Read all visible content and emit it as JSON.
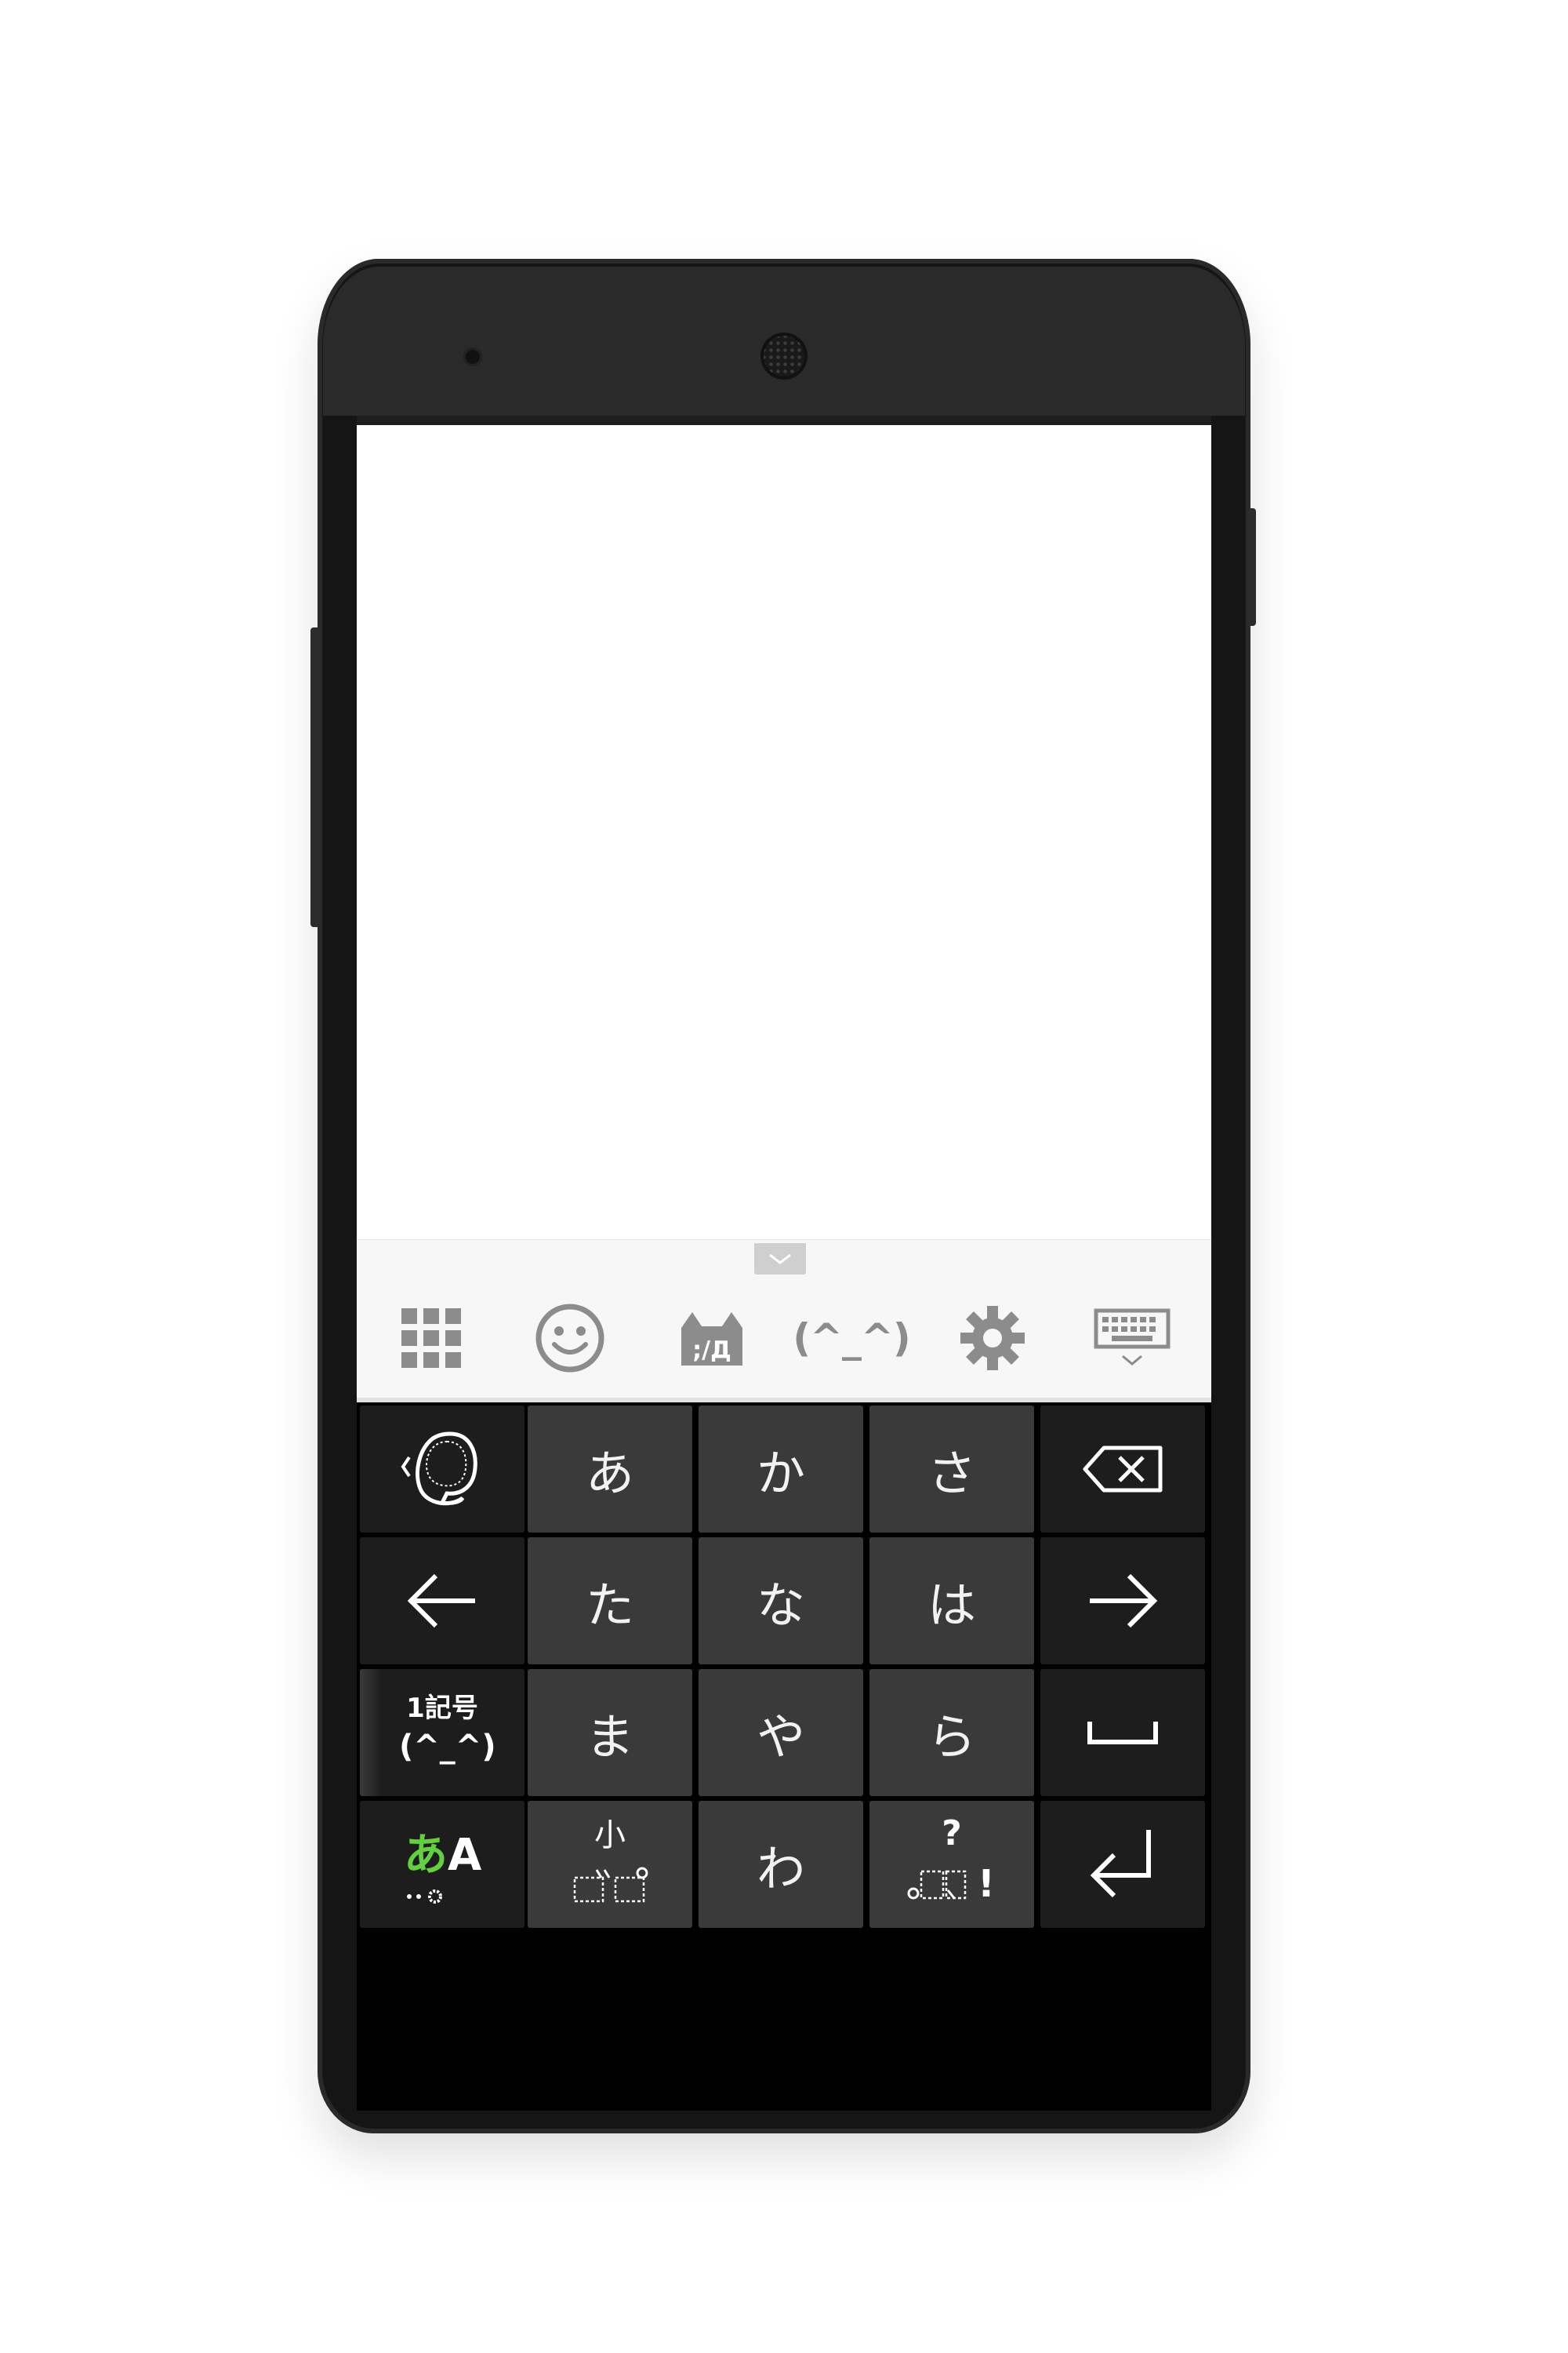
{
  "toolbar": {
    "items": [
      "grid-menu",
      "emoji",
      "cat-face",
      "kaomoji",
      "settings",
      "hide-keyboard"
    ],
    "kaomoji_label": "(^_^)"
  },
  "keyboard": {
    "row1": {
      "k1": "あ",
      "k2": "か",
      "k3": "さ"
    },
    "row2": {
      "k1": "た",
      "k2": "な",
      "k3": "は"
    },
    "row3": {
      "k1": "ま",
      "k2": "や",
      "k3": "ら"
    },
    "row4": {
      "k2": "わ"
    },
    "symbol_key": {
      "line1": "1記号",
      "line2": "(^_^)"
    },
    "mode_key": {
      "hiragana": "あ",
      "latin": "A"
    },
    "small_key": {
      "label": "小"
    },
    "punct_key": {
      "question": "?",
      "exclaim": "!"
    }
  },
  "colors": {
    "key_light": "#3a3a3a",
    "key_dark": "#1d1d1d",
    "toolbar_bg": "#f7f7f7",
    "toolbar_icon": "#8c8c8c",
    "mode_accent": "#63d13f"
  }
}
